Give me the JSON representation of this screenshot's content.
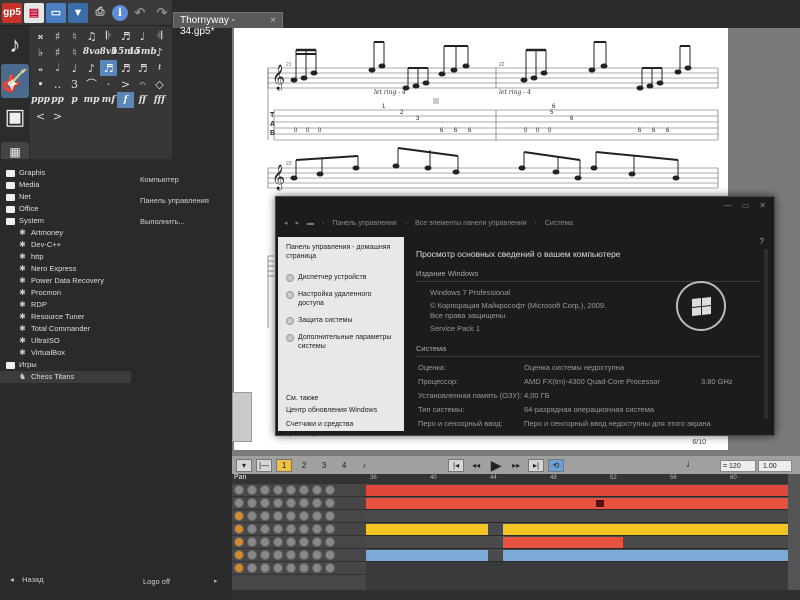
{
  "toolbar": {
    "logo": "gp5",
    "icons": [
      "new-file-icon",
      "open-folder-icon",
      "save-icon",
      "print-icon",
      "info-icon",
      "undo-icon",
      "redo-icon"
    ]
  },
  "palette": {
    "row_dynamics": [
      "ppp",
      "pp",
      "p",
      "mp",
      "mf",
      "f",
      "ff",
      "fff"
    ],
    "row3_text": [
      "8va",
      "8vb",
      "15ma",
      "15mb"
    ]
  },
  "tab": {
    "title": "Thornyway - 34.gp5*",
    "close": "×"
  },
  "score": {
    "measure_a": "21",
    "measure_b": "22",
    "measure_c": "23",
    "let_ring_1": "let ring - 4",
    "let_ring_2": "let ring - 4",
    "tab_letters": [
      "T",
      "A",
      "B"
    ],
    "page_num": "6/10"
  },
  "startmenu": {
    "programs": [
      {
        "label": "Graphis",
        "type": "folder"
      },
      {
        "label": "Media",
        "type": "folder"
      },
      {
        "label": "Net",
        "type": "folder"
      },
      {
        "label": "Office",
        "type": "folder"
      },
      {
        "label": "System",
        "type": "folder"
      },
      {
        "label": "Artmoney",
        "type": "app"
      },
      {
        "label": "Dev-C++",
        "type": "app"
      },
      {
        "label": "http",
        "type": "app"
      },
      {
        "label": "Nero Express",
        "type": "app"
      },
      {
        "label": "Power Data Recovery",
        "type": "app"
      },
      {
        "label": "Procmon",
        "type": "app"
      },
      {
        "label": "RDP",
        "type": "app"
      },
      {
        "label": "Resource Tuner",
        "type": "app"
      },
      {
        "label": "Total Commander",
        "type": "app"
      },
      {
        "label": "UltraISO",
        "type": "app"
      },
      {
        "label": "VirtualBox",
        "type": "app"
      },
      {
        "label": "Игры",
        "type": "folder"
      },
      {
        "label": "Chess Titans",
        "type": "app"
      }
    ],
    "right_links": [
      "Компьютер",
      "Панель управления",
      "Выполнить..."
    ],
    "back": "Назад",
    "logoff": "Logo off"
  },
  "controlpanel": {
    "breadcrumb": [
      "Панель управления",
      "Все элементы панели управления",
      "Система"
    ],
    "home": "Панель управления - домашняя страница",
    "links": [
      "Диспетчер устройств",
      "Настройка удаленного доступа",
      "Защита системы",
      "Дополнительные параметры системы"
    ],
    "see_also": "См. также",
    "see_also_links": [
      "Центр обновления Windows",
      "Счетчики и средства производительности"
    ],
    "title": "Просмотр основных сведений о вашем компьютере",
    "edition_header": "Издание Windows",
    "edition": "Windows 7 Professional",
    "copyright": "© Корпорация Майкрософт (Microsoft Corp.), 2009. Все права защищены.",
    "service_pack": "Service Pack 1",
    "system_header": "Система",
    "rows": [
      {
        "k": "Оценка:",
        "v": "Оценка системы недоступна",
        "v2": ""
      },
      {
        "k": "Процессор:",
        "v": "AMD FX(tm)-4300 Quad-Core Processor",
        "v2": "3.80 GHz"
      },
      {
        "k": "Установленная память (ОЗУ):",
        "v": "4,00 ГБ",
        "v2": ""
      },
      {
        "k": "Тип системы:",
        "v": "64-разрядная операционная система",
        "v2": ""
      },
      {
        "k": "Перо и сенсорный ввод:",
        "v": "Перо и сенсорный ввод недоступны для этого экрана",
        "v2": ""
      }
    ]
  },
  "transport": {
    "voices": [
      "1",
      "2",
      "3",
      "4"
    ],
    "tempo": "= 120",
    "speed": "1.00"
  },
  "tracks": {
    "header": "Pan",
    "ruler": [
      "36",
      "40",
      "44",
      "48",
      "52",
      "56",
      "60"
    ]
  }
}
